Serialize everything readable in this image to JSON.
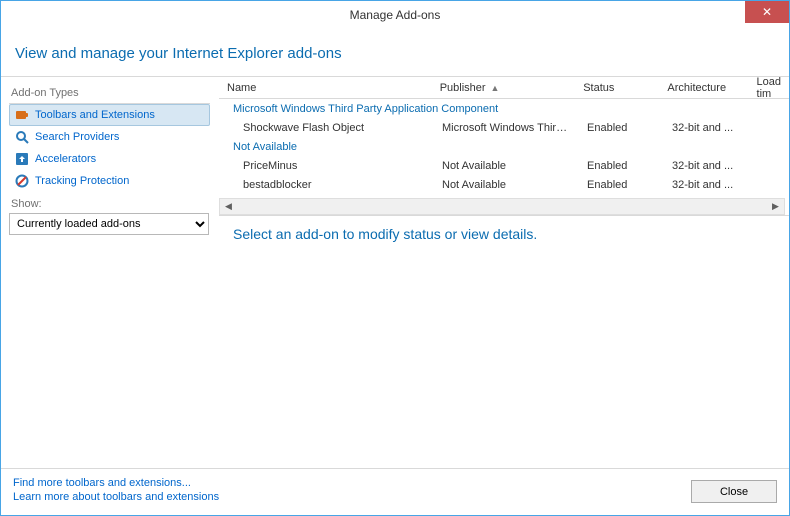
{
  "window": {
    "title": "Manage Add-ons"
  },
  "header": {
    "title": "View and manage your Internet Explorer add-ons"
  },
  "sidebar": {
    "heading": "Add-on Types",
    "items": [
      {
        "label": "Toolbars and Extensions",
        "icon": "puzzle-icon"
      },
      {
        "label": "Search Providers",
        "icon": "search-icon"
      },
      {
        "label": "Accelerators",
        "icon": "accelerator-icon"
      },
      {
        "label": "Tracking Protection",
        "icon": "block-icon"
      }
    ],
    "show_label": "Show:",
    "show_value": "Currently loaded add-ons"
  },
  "grid": {
    "columns": {
      "name": "Name",
      "publisher": "Publisher",
      "status": "Status",
      "architecture": "Architecture",
      "load_time": "Load tim"
    },
    "sort_column": "publisher",
    "sort_direction": "asc",
    "groups": [
      {
        "label": "Microsoft Windows Third Party Application Component",
        "rows": [
          {
            "name": "Shockwave Flash Object",
            "publisher": "Microsoft Windows Third...",
            "status": "Enabled",
            "architecture": "32-bit and ..."
          }
        ]
      },
      {
        "label": "Not Available",
        "rows": [
          {
            "name": "PriceMinus",
            "publisher": "Not Available",
            "status": "Enabled",
            "architecture": "32-bit and ..."
          },
          {
            "name": "bestadblocker",
            "publisher": "Not Available",
            "status": "Enabled",
            "architecture": "32-bit and ..."
          }
        ]
      }
    ]
  },
  "detail": {
    "message": "Select an add-on to modify status or view details."
  },
  "footer": {
    "find_link": "Find more toolbars and extensions...",
    "learn_link": "Learn more about toolbars and extensions",
    "close_label": "Close"
  }
}
